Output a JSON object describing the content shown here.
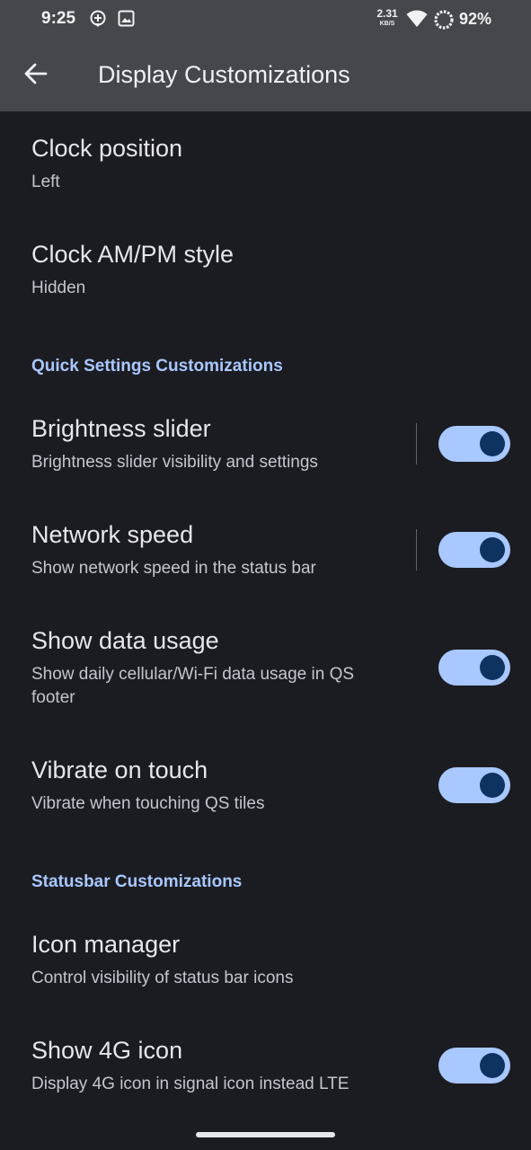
{
  "status_bar": {
    "time": "9:25",
    "net_speed_value": "2.31",
    "net_speed_unit": "KB/S",
    "battery_pct": "92%",
    "icons": [
      "location-pin-icon",
      "image-icon",
      "wifi-icon",
      "battery-saver-ring-icon"
    ]
  },
  "app_bar": {
    "title": "Display Customizations",
    "back_icon": "arrow-back-icon"
  },
  "prefs": {
    "clock_position": {
      "title": "Clock position",
      "summary": "Left"
    },
    "clock_ampm": {
      "title": "Clock AM/PM style",
      "summary": "Hidden"
    },
    "qs_header": "Quick Settings Customizations",
    "brightness_slider": {
      "title": "Brightness slider",
      "summary": "Brightness slider visibility and settings",
      "enabled": true
    },
    "network_speed": {
      "title": "Network speed",
      "summary": "Show network speed in the status bar",
      "enabled": true
    },
    "data_usage": {
      "title": "Show data usage",
      "summary": "Show daily cellular/Wi-Fi data usage in QS footer",
      "enabled": true
    },
    "vibrate_touch": {
      "title": "Vibrate on touch",
      "summary": "Vibrate when touching QS tiles",
      "enabled": true
    },
    "statusbar_header": "Statusbar Customizations",
    "icon_manager": {
      "title": "Icon manager",
      "summary": "Control visibility of status bar icons"
    },
    "show_4g": {
      "title": "Show 4G icon",
      "summary": "Display 4G icon in signal icon instead LTE",
      "enabled": true
    }
  },
  "colors": {
    "background": "#1b1c21",
    "top_bar": "#45474c",
    "accent": "#a9c7ff",
    "switch_track": "#a8c8ff",
    "switch_thumb": "#0e3361"
  }
}
